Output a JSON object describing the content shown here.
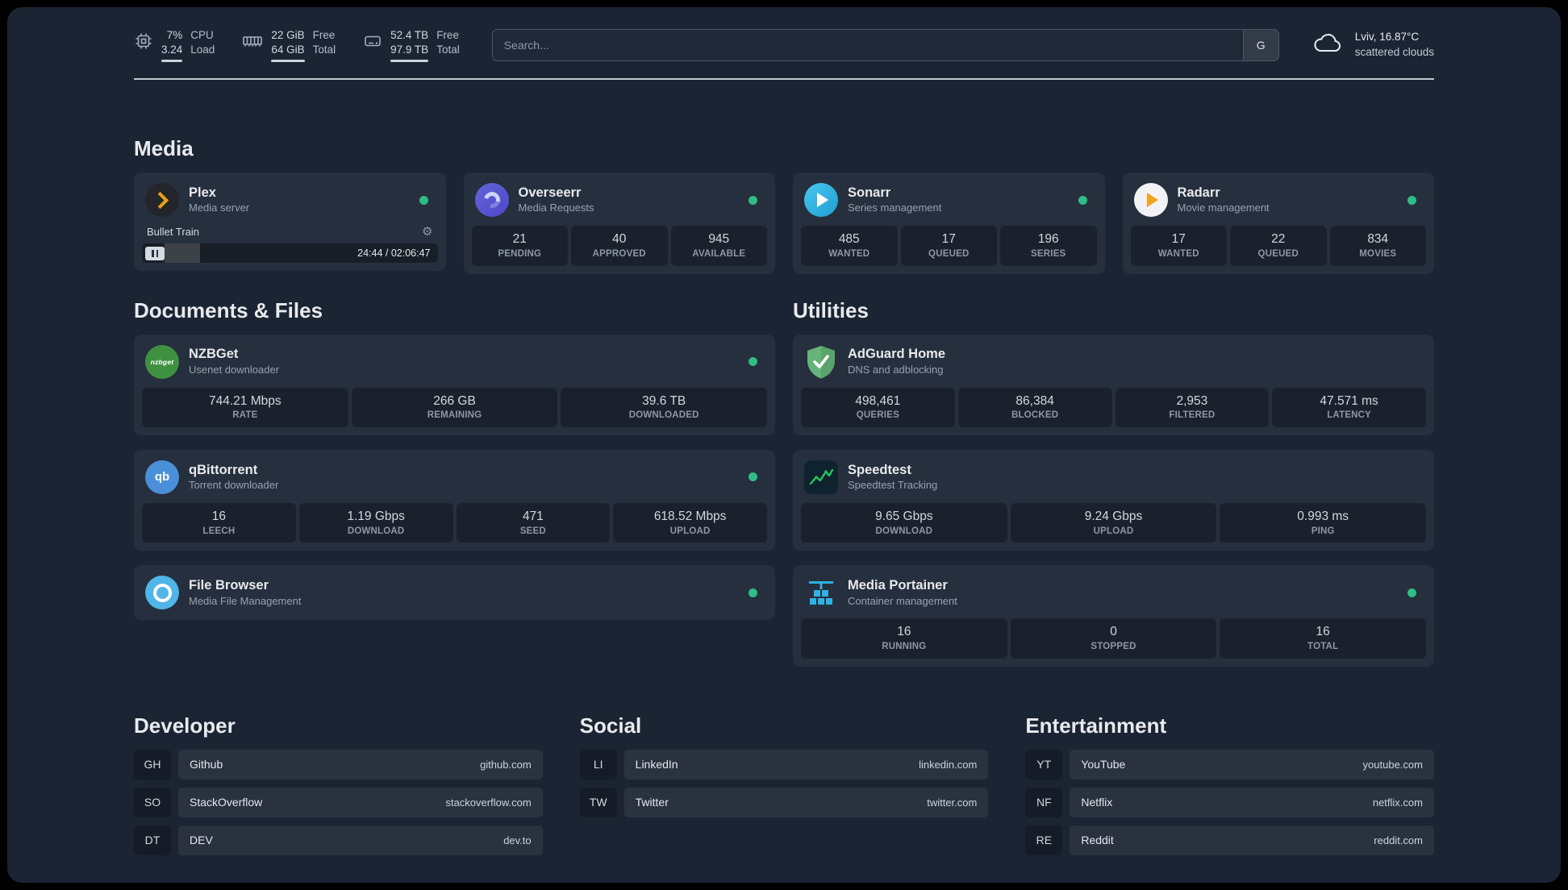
{
  "topbar": {
    "cpu": {
      "value_top": "7%",
      "value_bottom": "3.24",
      "label_top": "CPU",
      "label_bottom": "Load"
    },
    "memory": {
      "value_top": "22 GiB",
      "value_bottom": "64 GiB",
      "label_top": "Free",
      "label_bottom": "Total"
    },
    "disk": {
      "value_top": "52.4 TB",
      "value_bottom": "97.9 TB",
      "label_top": "Free",
      "label_bottom": "Total"
    },
    "search": {
      "placeholder": "Search...",
      "provider": "G"
    },
    "weather": {
      "location": "Lviv, 16.87°C",
      "condition": "scattered clouds"
    }
  },
  "sections": {
    "media": {
      "title": "Media"
    },
    "documents": {
      "title": "Documents & Files"
    },
    "utilities": {
      "title": "Utilities"
    }
  },
  "apps": {
    "plex": {
      "name": "Plex",
      "desc": "Media server",
      "now_playing": "Bullet Train",
      "time": "24:44 / 02:06:47"
    },
    "overseerr": {
      "name": "Overseerr",
      "desc": "Media Requests",
      "stats": [
        {
          "value": "21",
          "label": "PENDING"
        },
        {
          "value": "40",
          "label": "APPROVED"
        },
        {
          "value": "945",
          "label": "AVAILABLE"
        }
      ]
    },
    "sonarr": {
      "name": "Sonarr",
      "desc": "Series management",
      "stats": [
        {
          "value": "485",
          "label": "WANTED"
        },
        {
          "value": "17",
          "label": "QUEUED"
        },
        {
          "value": "196",
          "label": "SERIES"
        }
      ]
    },
    "radarr": {
      "name": "Radarr",
      "desc": "Movie management",
      "stats": [
        {
          "value": "17",
          "label": "WANTED"
        },
        {
          "value": "22",
          "label": "QUEUED"
        },
        {
          "value": "834",
          "label": "MOVIES"
        }
      ]
    },
    "nzbget": {
      "name": "NZBGet",
      "desc": "Usenet downloader",
      "stats": [
        {
          "value": "744.21 Mbps",
          "label": "RATE"
        },
        {
          "value": "266 GB",
          "label": "REMAINING"
        },
        {
          "value": "39.6 TB",
          "label": "DOWNLOADED"
        }
      ]
    },
    "qbittorrent": {
      "name": "qBittorrent",
      "desc": "Torrent downloader",
      "stats": [
        {
          "value": "16",
          "label": "LEECH"
        },
        {
          "value": "1.19 Gbps",
          "label": "DOWNLOAD"
        },
        {
          "value": "471",
          "label": "SEED"
        },
        {
          "value": "618.52 Mbps",
          "label": "UPLOAD"
        }
      ]
    },
    "filebrowser": {
      "name": "File Browser",
      "desc": "Media File Management"
    },
    "adguard": {
      "name": "AdGuard Home",
      "desc": "DNS and adblocking",
      "stats": [
        {
          "value": "498,461",
          "label": "QUERIES"
        },
        {
          "value": "86,384",
          "label": "BLOCKED"
        },
        {
          "value": "2,953",
          "label": "FILTERED"
        },
        {
          "value": "47.571 ms",
          "label": "LATENCY"
        }
      ]
    },
    "speedtest": {
      "name": "Speedtest",
      "desc": "Speedtest Tracking",
      "stats": [
        {
          "value": "9.65 Gbps",
          "label": "DOWNLOAD"
        },
        {
          "value": "9.24 Gbps",
          "label": "UPLOAD"
        },
        {
          "value": "0.993 ms",
          "label": "PING"
        }
      ]
    },
    "portainer": {
      "name": "Media Portainer",
      "desc": "Container management",
      "stats": [
        {
          "value": "16",
          "label": "RUNNING"
        },
        {
          "value": "0",
          "label": "STOPPED"
        },
        {
          "value": "16",
          "label": "TOTAL"
        }
      ]
    }
  },
  "bookmarks": {
    "developer": {
      "title": "Developer",
      "items": [
        {
          "abbr": "GH",
          "name": "Github",
          "url": "github.com"
        },
        {
          "abbr": "SO",
          "name": "StackOverflow",
          "url": "stackoverflow.com"
        },
        {
          "abbr": "DT",
          "name": "DEV",
          "url": "dev.to"
        }
      ]
    },
    "social": {
      "title": "Social",
      "items": [
        {
          "abbr": "LI",
          "name": "LinkedIn",
          "url": "linkedin.com"
        },
        {
          "abbr": "TW",
          "name": "Twitter",
          "url": "twitter.com"
        }
      ]
    },
    "entertainment": {
      "title": "Entertainment",
      "items": [
        {
          "abbr": "YT",
          "name": "YouTube",
          "url": "youtube.com"
        },
        {
          "abbr": "NF",
          "name": "Netflix",
          "url": "netflix.com"
        },
        {
          "abbr": "RE",
          "name": "Reddit",
          "url": "reddit.com"
        }
      ]
    }
  }
}
